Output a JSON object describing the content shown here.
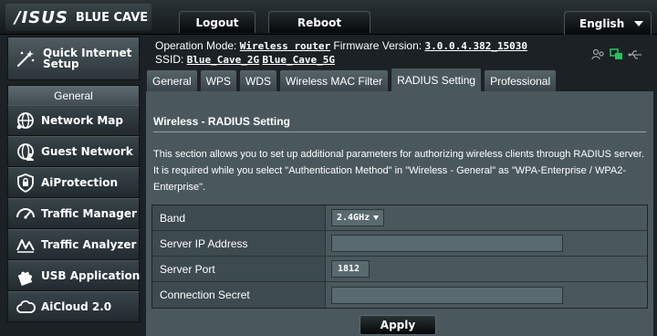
{
  "header": {
    "brand": "/ISUS",
    "model": "BLUE CAVE",
    "logout_label": "Logout",
    "reboot_label": "Reboot",
    "language": "English"
  },
  "sidebar": {
    "quick_setup": "Quick Internet Setup",
    "general_label": "General",
    "items": [
      {
        "label": "Network Map",
        "icon": "globe-network-icon"
      },
      {
        "label": "Guest Network",
        "icon": "guest-network-icon"
      },
      {
        "label": "AiProtection",
        "icon": "shield-lock-icon"
      },
      {
        "label": "Traffic Manager",
        "icon": "gauge-icon"
      },
      {
        "label": "Traffic Analyzer",
        "icon": "chart-analyzer-icon"
      },
      {
        "label": "USB Application",
        "icon": "puzzle-icon"
      },
      {
        "label": "AiCloud 2.0",
        "icon": "cloud-icon"
      }
    ]
  },
  "info": {
    "op_mode_label": "Operation Mode:",
    "op_mode_value": "Wireless router",
    "firmware_label": "Firmware Version:",
    "firmware_value": "3.0.0.4.382_15030",
    "ssid_label": "SSID:",
    "ssid_1": "Blue_Cave_2G",
    "ssid_2": "Blue_Cave_5G"
  },
  "tabs": [
    {
      "label": "General"
    },
    {
      "label": "WPS"
    },
    {
      "label": "WDS"
    },
    {
      "label": "Wireless MAC Filter"
    },
    {
      "label": "RADIUS Setting",
      "active": true
    },
    {
      "label": "Professional"
    }
  ],
  "content": {
    "title": "Wireless - RADIUS Setting",
    "description": "This section allows you to set up additional parameters for authorizing wireless clients through RADIUS server. It is required while you select \"Authentication Method\" in \"Wireless - General\" as \"WPA-Enterprise / WPA2-Enterprise\".",
    "form": {
      "band_label": "Band",
      "band_value": "2.4GHz",
      "server_ip_label": "Server IP Address",
      "server_ip_value": "",
      "server_port_label": "Server Port",
      "server_port_value": "1812",
      "secret_label": "Connection Secret",
      "secret_value": ""
    },
    "apply_label": "Apply"
  },
  "colors": {
    "background": "#1b2124",
    "panel": "#4a585e",
    "accent_green": "#22c35e"
  }
}
